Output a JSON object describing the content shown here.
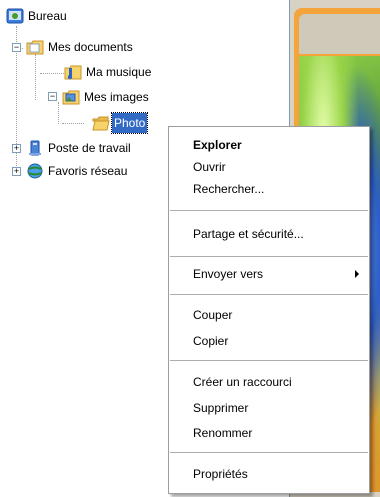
{
  "tree": {
    "desktop": "Bureau",
    "my_documents": "Mes documents",
    "my_music": "Ma musique",
    "my_pictures": "Mes images",
    "photo": "Photo",
    "computer": "Poste de travail",
    "network": "Favoris réseau"
  },
  "context_menu": {
    "explore": "Explorer",
    "open": "Ouvrir",
    "search": "Rechercher...",
    "sharing": "Partage et sécurité...",
    "send_to": "Envoyer vers",
    "cut": "Couper",
    "copy": "Copier",
    "create_shortcut": "Créer un raccourci",
    "delete": "Supprimer",
    "rename": "Renommer",
    "properties": "Propriétés"
  },
  "colors": {
    "selection": "#316ac5",
    "preview_frame": "#f3a43a"
  }
}
